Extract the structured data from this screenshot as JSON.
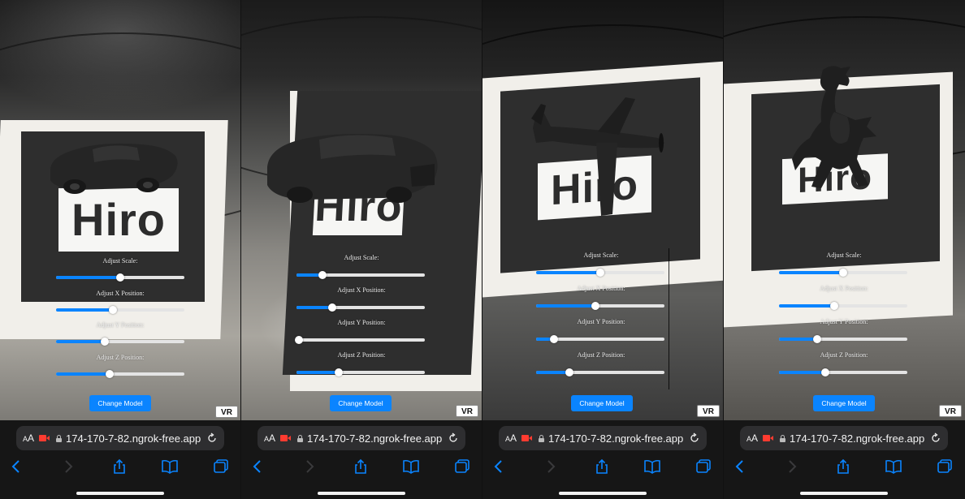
{
  "accent_color": "#0a84ff",
  "marker_text": "Hiro",
  "panels": [
    {
      "model": "car",
      "sliders": [
        {
          "label": "Adjust Scale:",
          "value": 0.5
        },
        {
          "label": "Adjust X Position:",
          "value": 0.44
        },
        {
          "label": "Adjust Y Position:",
          "value": 0.38
        },
        {
          "label": "Adjust Z Position:",
          "value": 0.42
        }
      ],
      "change_model_label": "Change Model",
      "vr_label": "VR",
      "browser": {
        "aa_label": "AA",
        "url": "174-170-7-82.ngrok-free.app"
      }
    },
    {
      "model": "car",
      "sliders": [
        {
          "label": "Adjust Scale:",
          "value": 0.2
        },
        {
          "label": "Adjust X Position:",
          "value": 0.28
        },
        {
          "label": "Adjust Y Position:",
          "value": 0.02
        },
        {
          "label": "Adjust Z Position:",
          "value": 0.33
        }
      ],
      "change_model_label": "Change Model",
      "vr_label": "VR",
      "browser": {
        "aa_label": "AA",
        "url": "174-170-7-82.ngrok-free.app"
      }
    },
    {
      "model": "airplane",
      "sliders": [
        {
          "label": "Adjust Scale:",
          "value": 0.5
        },
        {
          "label": "Adjust X Position:",
          "value": 0.46
        },
        {
          "label": "Adjust Y Position:",
          "value": 0.14
        },
        {
          "label": "Adjust Z Position:",
          "value": 0.26
        }
      ],
      "change_model_label": "Change Model",
      "vr_label": "VR",
      "browser": {
        "aa_label": "AA",
        "url": "174-170-7-82.ngrok-free.app"
      }
    },
    {
      "model": "dragon",
      "sliders": [
        {
          "label": "Adjust Scale:",
          "value": 0.5
        },
        {
          "label": "Adjust X Position:",
          "value": 0.43
        },
        {
          "label": "Adjust Y Position:",
          "value": 0.3
        },
        {
          "label": "Adjust Z Position:",
          "value": 0.36
        }
      ],
      "change_model_label": "Change Model",
      "vr_label": "VR",
      "browser": {
        "aa_label": "AA",
        "url": "174-170-7-82.ngrok-free.app"
      }
    }
  ],
  "icons": [
    "camera-recording-icon",
    "lock-icon",
    "reload-icon",
    "back-icon",
    "forward-icon",
    "share-icon",
    "bookmarks-icon",
    "tabs-icon"
  ]
}
